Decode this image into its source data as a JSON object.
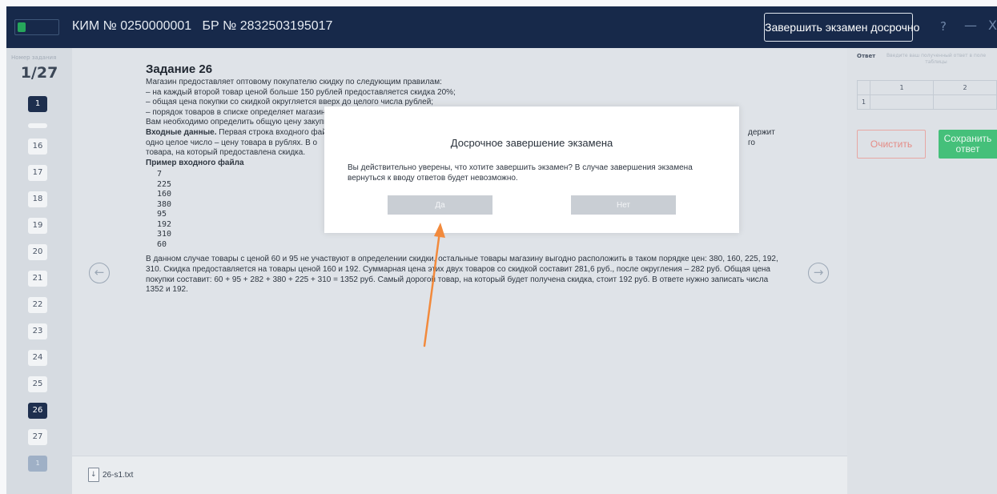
{
  "header": {
    "kim_label": "КИМ № 0250000001",
    "br_label": "БР № 2832503195017",
    "finish_button": "Завершить экзамен досрочно",
    "help_glyph": "?",
    "minimize_glyph": "—",
    "close_glyph": "X"
  },
  "sidebar": {
    "caption": "Номер задания",
    "counter": "1/27",
    "first_item": "1",
    "items": [
      "16",
      "17",
      "18",
      "19",
      "20",
      "21",
      "22",
      "23",
      "24",
      "25",
      "26",
      "27"
    ],
    "current": "26",
    "last_item": "1"
  },
  "task": {
    "title": "Задание 26",
    "lines": [
      "Магазин предоставляет оптовому покупателю скидку по следующим правилам:",
      "– на каждый второй товар ценой больше 150 рублей предоставляется скидка 20%;",
      "– общая цена покупки со скидкой округляется вверх до целого числа рублей;",
      "– порядок товаров в списке определяет магазин",
      "Вам необходимо определить общую цену закупки"
    ],
    "input_label": "Входные данные.",
    "input_text_1": " Первая строка входного файла",
    "input_text_1b": "держит",
    "input_text_2": "одно целое число – цену товара в рублях. В о",
    "input_text_2b": "го",
    "input_text_3": "товара, на который предоставлена скидка.",
    "example_title": "Пример входного файла",
    "example_values": [
      "7",
      "225",
      "160",
      "380",
      "95",
      "192",
      "310",
      "60"
    ],
    "explanation": "В данном случае товары с ценой 60 и 95 не участвуют в определении скидки, остальные товары магазину выгодно расположить в таком порядке цен: 380, 160, 225, 192, 310. Скидка предоставляется на товары ценой 160 и 192. Суммарная цена этих двух товаров со скидкой составит 281,6 руб., после округления – 282 руб. Общая цена покупки составит: 60 + 95 + 282 + 380 + 225 + 310 = 1352 руб. Самый дорогой товар, на который будет получена скидка, стоит 192 руб. В ответе нужно записать числа 1352 и 192."
  },
  "file": {
    "name": "26-s1.txt"
  },
  "answer": {
    "label": "Ответ",
    "hint": "Введите ваш полученный ответ в поле таблицы",
    "col_headers": [
      "1",
      "2"
    ],
    "row_header": "1",
    "clear_button": "Очистить",
    "save_line1": "Сохранить",
    "save_line2": "ответ"
  },
  "modal": {
    "title": "Досрочное завершение экзамена",
    "message": "Вы действительно уверены, что хотите завершить экзамен? В случае завершения экзамена вернуться к вводу ответов будет невозможно.",
    "yes": "Да",
    "no": "Нет"
  },
  "colors": {
    "header_bg": "#17294a",
    "annotation_arrow": "#f28a3c",
    "save_green": "#45c07a",
    "clear_red": "#e58c86"
  }
}
